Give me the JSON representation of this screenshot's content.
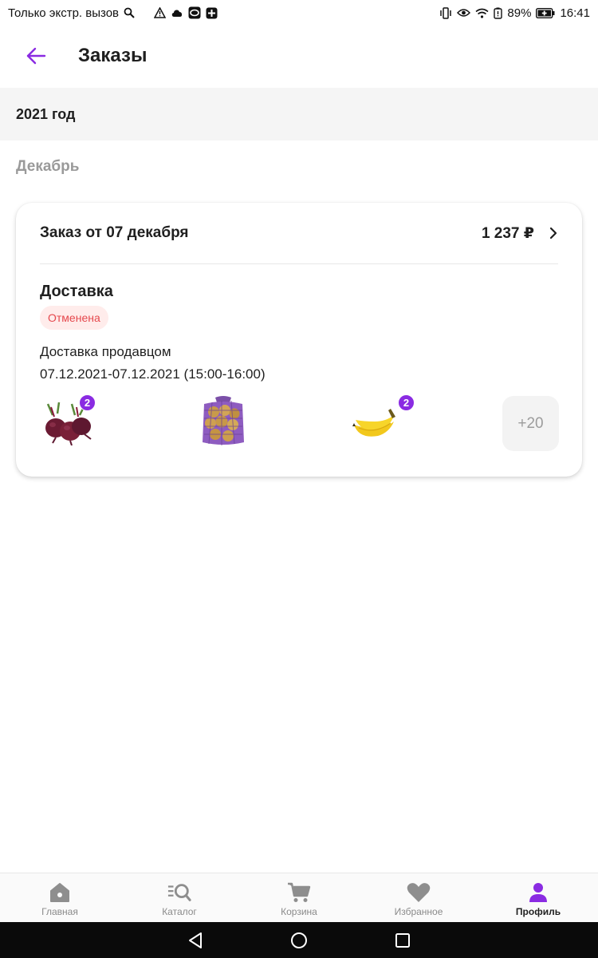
{
  "status_bar": {
    "carrier": "Только экстр. вызов",
    "battery": "89%",
    "time": "16:41"
  },
  "header": {
    "title": "Заказы"
  },
  "year_label": "2021 год",
  "month_label": "Декабрь",
  "order": {
    "title": "Заказ от 07 декабря",
    "total": "1 237 ₽",
    "delivery_type": "Доставка",
    "status": "Отменена",
    "delivery_method": "Доставка продавцом",
    "delivery_interval": "07.12.2021-07.12.2021 (15:00-16:00)",
    "items": [
      {
        "icon": "beetroot-image",
        "qty": "2"
      },
      {
        "icon": "potato-sack-image",
        "qty": ""
      },
      {
        "icon": "banana-image",
        "qty": "2"
      }
    ],
    "more_label": "+20"
  },
  "bottom_nav": {
    "items": [
      {
        "label": "Главная",
        "icon": "home-icon"
      },
      {
        "label": "Каталог",
        "icon": "catalog-search-icon"
      },
      {
        "label": "Корзина",
        "icon": "cart-icon"
      },
      {
        "label": "Избранное",
        "icon": "heart-icon"
      },
      {
        "label": "Профиль",
        "icon": "profile-icon"
      }
    ],
    "active": "Профиль"
  },
  "colors": {
    "accent": "#8a2be2",
    "status_text": "#e5484d",
    "status_bg": "#ffeceb"
  }
}
